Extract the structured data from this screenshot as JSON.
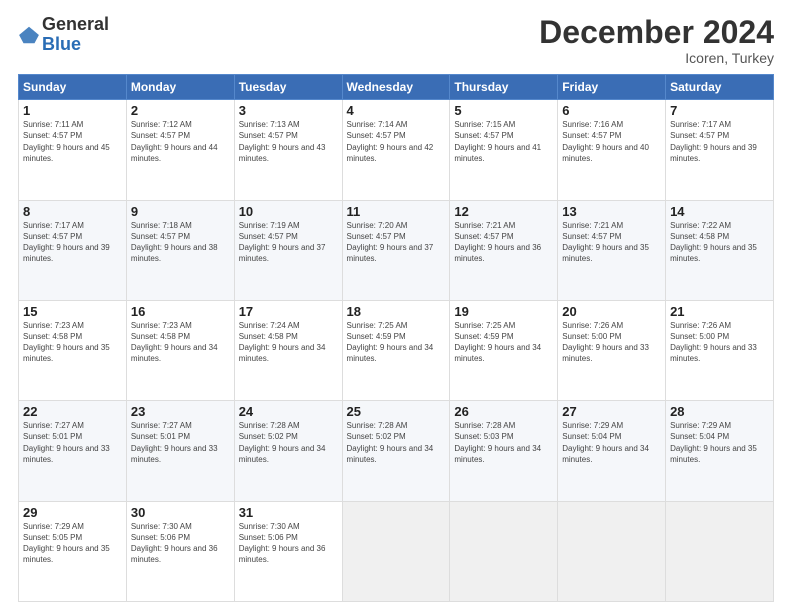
{
  "header": {
    "logo_general": "General",
    "logo_blue": "Blue",
    "title": "December 2024",
    "subtitle": "Icoren, Turkey"
  },
  "days_of_week": [
    "Sunday",
    "Monday",
    "Tuesday",
    "Wednesday",
    "Thursday",
    "Friday",
    "Saturday"
  ],
  "weeks": [
    [
      {
        "day": "1",
        "sunrise": "7:11 AM",
        "sunset": "4:57 PM",
        "daylight": "9 hours and 45 minutes."
      },
      {
        "day": "2",
        "sunrise": "7:12 AM",
        "sunset": "4:57 PM",
        "daylight": "9 hours and 44 minutes."
      },
      {
        "day": "3",
        "sunrise": "7:13 AM",
        "sunset": "4:57 PM",
        "daylight": "9 hours and 43 minutes."
      },
      {
        "day": "4",
        "sunrise": "7:14 AM",
        "sunset": "4:57 PM",
        "daylight": "9 hours and 42 minutes."
      },
      {
        "day": "5",
        "sunrise": "7:15 AM",
        "sunset": "4:57 PM",
        "daylight": "9 hours and 41 minutes."
      },
      {
        "day": "6",
        "sunrise": "7:16 AM",
        "sunset": "4:57 PM",
        "daylight": "9 hours and 40 minutes."
      },
      {
        "day": "7",
        "sunrise": "7:17 AM",
        "sunset": "4:57 PM",
        "daylight": "9 hours and 39 minutes."
      }
    ],
    [
      {
        "day": "8",
        "sunrise": "7:17 AM",
        "sunset": "4:57 PM",
        "daylight": "9 hours and 39 minutes."
      },
      {
        "day": "9",
        "sunrise": "7:18 AM",
        "sunset": "4:57 PM",
        "daylight": "9 hours and 38 minutes."
      },
      {
        "day": "10",
        "sunrise": "7:19 AM",
        "sunset": "4:57 PM",
        "daylight": "9 hours and 37 minutes."
      },
      {
        "day": "11",
        "sunrise": "7:20 AM",
        "sunset": "4:57 PM",
        "daylight": "9 hours and 37 minutes."
      },
      {
        "day": "12",
        "sunrise": "7:21 AM",
        "sunset": "4:57 PM",
        "daylight": "9 hours and 36 minutes."
      },
      {
        "day": "13",
        "sunrise": "7:21 AM",
        "sunset": "4:57 PM",
        "daylight": "9 hours and 35 minutes."
      },
      {
        "day": "14",
        "sunrise": "7:22 AM",
        "sunset": "4:58 PM",
        "daylight": "9 hours and 35 minutes."
      }
    ],
    [
      {
        "day": "15",
        "sunrise": "7:23 AM",
        "sunset": "4:58 PM",
        "daylight": "9 hours and 35 minutes."
      },
      {
        "day": "16",
        "sunrise": "7:23 AM",
        "sunset": "4:58 PM",
        "daylight": "9 hours and 34 minutes."
      },
      {
        "day": "17",
        "sunrise": "7:24 AM",
        "sunset": "4:58 PM",
        "daylight": "9 hours and 34 minutes."
      },
      {
        "day": "18",
        "sunrise": "7:25 AM",
        "sunset": "4:59 PM",
        "daylight": "9 hours and 34 minutes."
      },
      {
        "day": "19",
        "sunrise": "7:25 AM",
        "sunset": "4:59 PM",
        "daylight": "9 hours and 34 minutes."
      },
      {
        "day": "20",
        "sunrise": "7:26 AM",
        "sunset": "5:00 PM",
        "daylight": "9 hours and 33 minutes."
      },
      {
        "day": "21",
        "sunrise": "7:26 AM",
        "sunset": "5:00 PM",
        "daylight": "9 hours and 33 minutes."
      }
    ],
    [
      {
        "day": "22",
        "sunrise": "7:27 AM",
        "sunset": "5:01 PM",
        "daylight": "9 hours and 33 minutes."
      },
      {
        "day": "23",
        "sunrise": "7:27 AM",
        "sunset": "5:01 PM",
        "daylight": "9 hours and 33 minutes."
      },
      {
        "day": "24",
        "sunrise": "7:28 AM",
        "sunset": "5:02 PM",
        "daylight": "9 hours and 34 minutes."
      },
      {
        "day": "25",
        "sunrise": "7:28 AM",
        "sunset": "5:02 PM",
        "daylight": "9 hours and 34 minutes."
      },
      {
        "day": "26",
        "sunrise": "7:28 AM",
        "sunset": "5:03 PM",
        "daylight": "9 hours and 34 minutes."
      },
      {
        "day": "27",
        "sunrise": "7:29 AM",
        "sunset": "5:04 PM",
        "daylight": "9 hours and 34 minutes."
      },
      {
        "day": "28",
        "sunrise": "7:29 AM",
        "sunset": "5:04 PM",
        "daylight": "9 hours and 35 minutes."
      }
    ],
    [
      {
        "day": "29",
        "sunrise": "7:29 AM",
        "sunset": "5:05 PM",
        "daylight": "9 hours and 35 minutes."
      },
      {
        "day": "30",
        "sunrise": "7:30 AM",
        "sunset": "5:06 PM",
        "daylight": "9 hours and 36 minutes."
      },
      {
        "day": "31",
        "sunrise": "7:30 AM",
        "sunset": "5:06 PM",
        "daylight": "9 hours and 36 minutes."
      },
      null,
      null,
      null,
      null
    ]
  ]
}
